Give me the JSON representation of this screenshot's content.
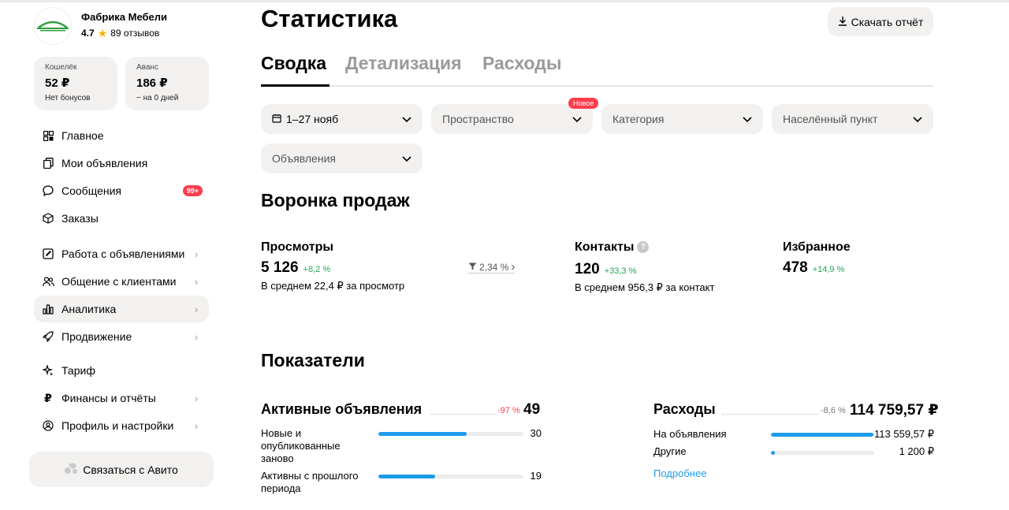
{
  "seller": {
    "name": "Фабрика Мебели",
    "rating": "4.7",
    "reviews": "89 отзывов"
  },
  "wallet": {
    "label": "Кошелёк",
    "value": "52 ₽",
    "sub": "Нет бонусов"
  },
  "advance": {
    "label": "Аванс",
    "value": "186 ₽",
    "sub": "~ на 0 дней"
  },
  "nav": [
    {
      "label": "Главное",
      "icon": "grid-icon"
    },
    {
      "label": "Мои объявления",
      "icon": "copy-icon"
    },
    {
      "label": "Сообщения",
      "icon": "chat-icon",
      "badge": "99+"
    },
    {
      "label": "Заказы",
      "icon": "box-icon"
    },
    {
      "label": "Работа с объявлениями",
      "icon": "edit-icon"
    },
    {
      "label": "Общение с клиентами",
      "icon": "users-icon"
    },
    {
      "label": "Аналитика",
      "icon": "chart-icon"
    },
    {
      "label": "Продвижение",
      "icon": "rocket-icon"
    },
    {
      "label": "Тариф",
      "icon": "sparkle-icon"
    },
    {
      "label": "Финансы и отчёты",
      "icon": "ruble-icon"
    },
    {
      "label": "Профиль и настройки",
      "icon": "profile-icon"
    }
  ],
  "contact_button": "Связаться с Авито",
  "page_title": "Статистика",
  "download_button": "Скачать отчёт",
  "tabs": [
    "Сводка",
    "Детализация",
    "Расходы"
  ],
  "filters": {
    "period": "1–27 нояб",
    "space": "Пространство",
    "space_badge": "Новое",
    "category": "Категория",
    "city": "Населённый пункт",
    "ads": "Объявления"
  },
  "funnel": {
    "title": "Воронка продаж",
    "views": {
      "title": "Просмотры",
      "value": "5 126",
      "delta": "+8,2 %",
      "sub": "В среднем 22,4 ₽ за просмотр",
      "conversion": "2,34 %"
    },
    "contacts": {
      "title": "Контакты",
      "value": "120",
      "delta": "+33,3 %",
      "sub": "В среднем 956,3 ₽ за контакт"
    },
    "favorites": {
      "title": "Избранное",
      "value": "478",
      "delta": "+14,9 %"
    }
  },
  "indicators": {
    "title": "Показатели",
    "active_ads": {
      "title": "Активные объявления",
      "delta": "-97 %",
      "value": "49",
      "rows": [
        {
          "label": "Новые и опубликованные заново",
          "value": "30",
          "fraction": 0.61
        },
        {
          "label": "Активны с прошлого периода",
          "value": "19",
          "fraction": 0.39
        }
      ]
    },
    "expenses": {
      "title": "Расходы",
      "delta": "-8,6 %",
      "value": "114 759,57 ₽",
      "rows": [
        {
          "label": "На объявления",
          "value": "113 559,57 ₽",
          "fraction": 0.99
        },
        {
          "label": "Другие",
          "value": "1 200 ₽",
          "fraction": 0.04
        }
      ],
      "more_link": "Подробнее"
    }
  }
}
